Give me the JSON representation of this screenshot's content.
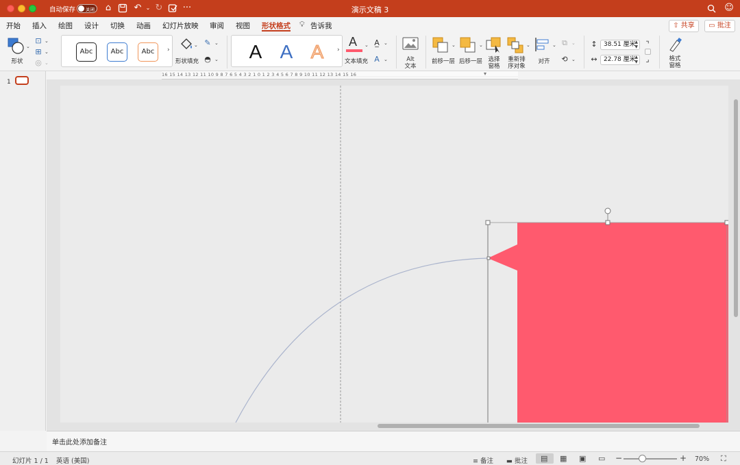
{
  "titlebar": {
    "autosave_label": "自动保存",
    "autosave_state": "关闭",
    "doc_title": "演示文稿 3"
  },
  "tabs": [
    {
      "label": "开始"
    },
    {
      "label": "插入"
    },
    {
      "label": "绘图"
    },
    {
      "label": "设计"
    },
    {
      "label": "切换"
    },
    {
      "label": "动画"
    },
    {
      "label": "幻灯片放映"
    },
    {
      "label": "审阅"
    },
    {
      "label": "视图"
    },
    {
      "label": "形状格式",
      "active": true
    },
    {
      "label": "告诉我"
    }
  ],
  "header_buttons": {
    "share": "共享",
    "comments": "批注"
  },
  "ribbon": {
    "shapes_label": "形状",
    "style_samples": [
      "Abc",
      "Abc",
      "Abc"
    ],
    "shape_fill_label": "形状填充",
    "wordart_samples": [
      "A",
      "A",
      "A"
    ],
    "text_fill_label": "文本填充",
    "alt_text_label": "Alt\n文本",
    "bring_forward_label": "前移一层",
    "send_backward_label": "后移一层",
    "selection_pane_label": "选择\n窗格",
    "reorder_label": "重新排\n序对象",
    "align_label": "对齐",
    "height_value": "38.51 厘米",
    "width_value": "22.78 厘米",
    "format_pane_label": "格式\n窗格"
  },
  "ruler": {
    "numbers": "16  15  14  13  12  11  10   9    8    7    6    5    4    3    2    1    0    1    2    3    4    5    6    7    8    9   10  11  12  13  14  15  16"
  },
  "thumbnails": {
    "slide_number": "1"
  },
  "notes": {
    "placeholder": "单击此处添加备注"
  },
  "statusbar": {
    "slide_info": "幻灯片 1 / 1",
    "language": "英语 (美国)",
    "notes_label": "备注",
    "comments_label": "批注",
    "zoom_percent": "70%",
    "zoom_level": 0.7
  },
  "colors": {
    "brand": "#c43e1c",
    "shape_fill": "#ff5a6e",
    "arc": "#a9b3cc"
  }
}
